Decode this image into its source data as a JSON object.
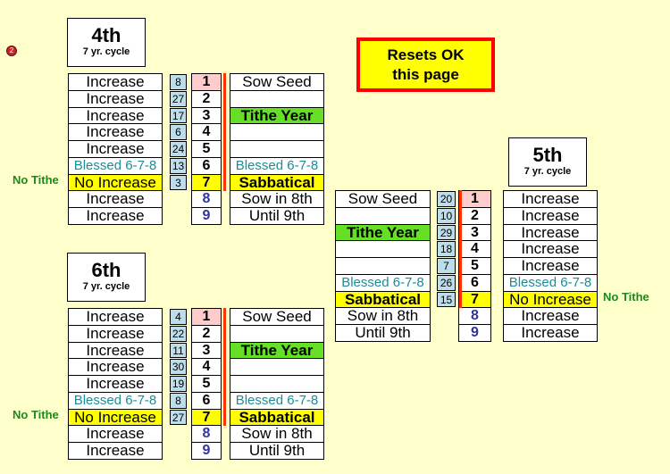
{
  "dot_label": "2",
  "resets": {
    "line1": "Resets OK",
    "line2": "this page"
  },
  "no_tithe": "No Tithe",
  "cycle4": {
    "title": "4th",
    "subtitle": "7 yr. cycle",
    "left": [
      "Increase",
      "Increase",
      "Increase",
      "Increase",
      "Increase",
      "Blessed 6-7-8",
      "No Increase",
      "Increase",
      "Increase"
    ],
    "small": [
      "8",
      "27",
      "17",
      "6",
      "24",
      "13",
      "3"
    ],
    "nums": [
      "1",
      "2",
      "3",
      "4",
      "5",
      "6",
      "7",
      "8",
      "9"
    ],
    "right": [
      "Sow Seed",
      "",
      "Tithe Year",
      "",
      "",
      "Blessed 6-7-8",
      "Sabbatical",
      "Sow in 8th",
      "Until 9th"
    ]
  },
  "cycle5": {
    "title": "5th",
    "subtitle": "7 yr. cycle",
    "left": [
      "Sow Seed",
      "",
      "Tithe Year",
      "",
      "",
      "Blessed 6-7-8",
      "Sabbatical",
      "Sow in 8th",
      "Until 9th"
    ],
    "small": [
      "20",
      "10",
      "29",
      "18",
      "7",
      "26",
      "15"
    ],
    "nums": [
      "1",
      "2",
      "3",
      "4",
      "5",
      "6",
      "7",
      "8",
      "9"
    ],
    "right": [
      "Increase",
      "Increase",
      "Increase",
      "Increase",
      "Increase",
      "Blessed 6-7-8",
      "No Increase",
      "Increase",
      "Increase"
    ]
  },
  "cycle6": {
    "title": "6th",
    "subtitle": "7 yr. cycle",
    "left": [
      "Increase",
      "Increase",
      "Increase",
      "Increase",
      "Increase",
      "Blessed 6-7-8",
      "No Increase",
      "Increase",
      "Increase"
    ],
    "small": [
      "4",
      "22",
      "11",
      "30",
      "19",
      "8",
      "27"
    ],
    "nums": [
      "1",
      "2",
      "3",
      "4",
      "5",
      "6",
      "7",
      "8",
      "9"
    ],
    "right": [
      "Sow Seed",
      "",
      "Tithe Year",
      "",
      "",
      "Blessed 6-7-8",
      "Sabbatical",
      "Sow in 8th",
      "Until 9th"
    ]
  }
}
